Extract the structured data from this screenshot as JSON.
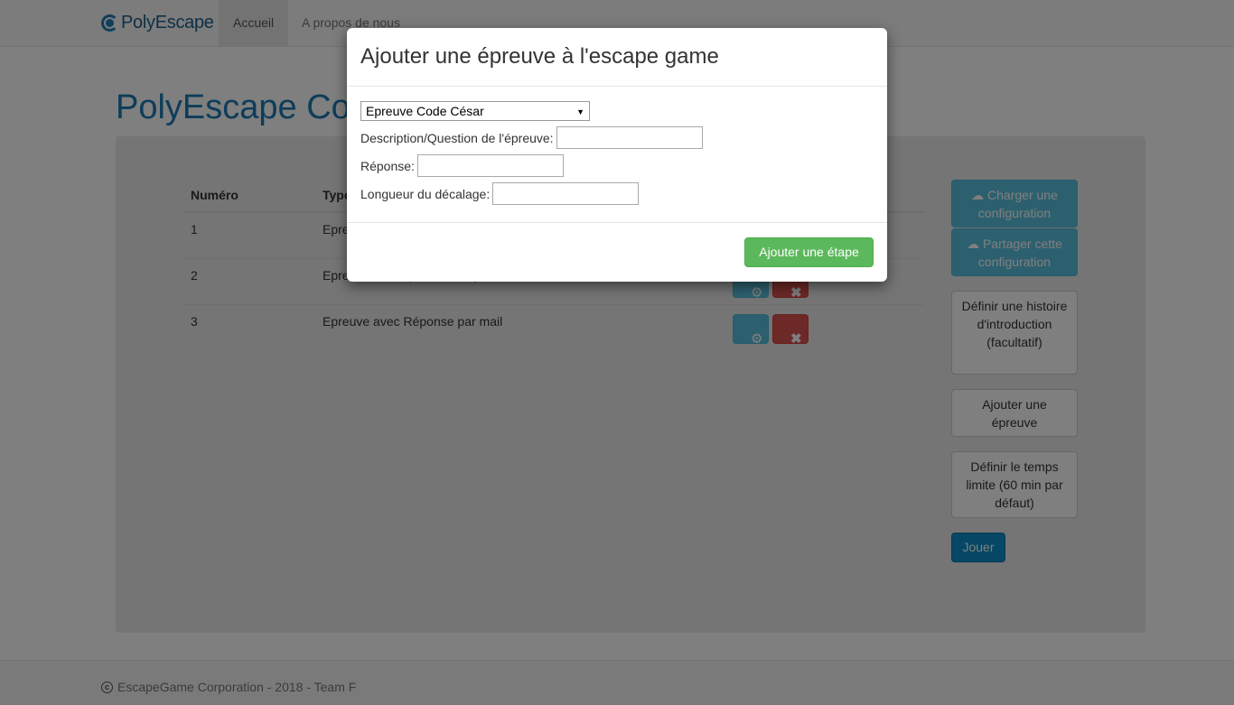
{
  "navbar": {
    "brand": "PolyEscape",
    "items": [
      {
        "label": "Accueil",
        "active": true
      },
      {
        "label": "A propos de nous",
        "active": false
      }
    ]
  },
  "page": {
    "title": "PolyEscape Configuration"
  },
  "table": {
    "headers": [
      "Numéro",
      "Type"
    ],
    "rows": [
      {
        "num": "1",
        "type": "Epreuve avec Code César"
      },
      {
        "num": "2",
        "type": "Epreuve avec Question/Réponse"
      },
      {
        "num": "3",
        "type": "Epreuve avec Réponse par mail"
      }
    ]
  },
  "sidebar": {
    "load_config": "Charger une configuration",
    "share_config": "Partager cette configuration",
    "define_story": "Définir une histoire d'introduction (facultatif)",
    "add_step": "Ajouter une épreuve",
    "define_time": "Définir le temps limite (60 min par défaut)",
    "play": "Jouer"
  },
  "modal": {
    "title": "Ajouter une épreuve à l'escape game",
    "select_value": "Epreuve Code César",
    "fields": {
      "description_label": "Description/Question de l'épreuve:",
      "answer_label": "Réponse:",
      "shift_label": "Longueur du décalage:"
    },
    "submit": "Ajouter une étape"
  },
  "footer": {
    "text": "EscapeGame Corporation - 2018 - Team F"
  },
  "colors": {
    "brand": "#1a7ab5",
    "info": "#5bc0de",
    "danger": "#d9534f",
    "success": "#5cb85c",
    "primary": "#0a8fc8"
  }
}
